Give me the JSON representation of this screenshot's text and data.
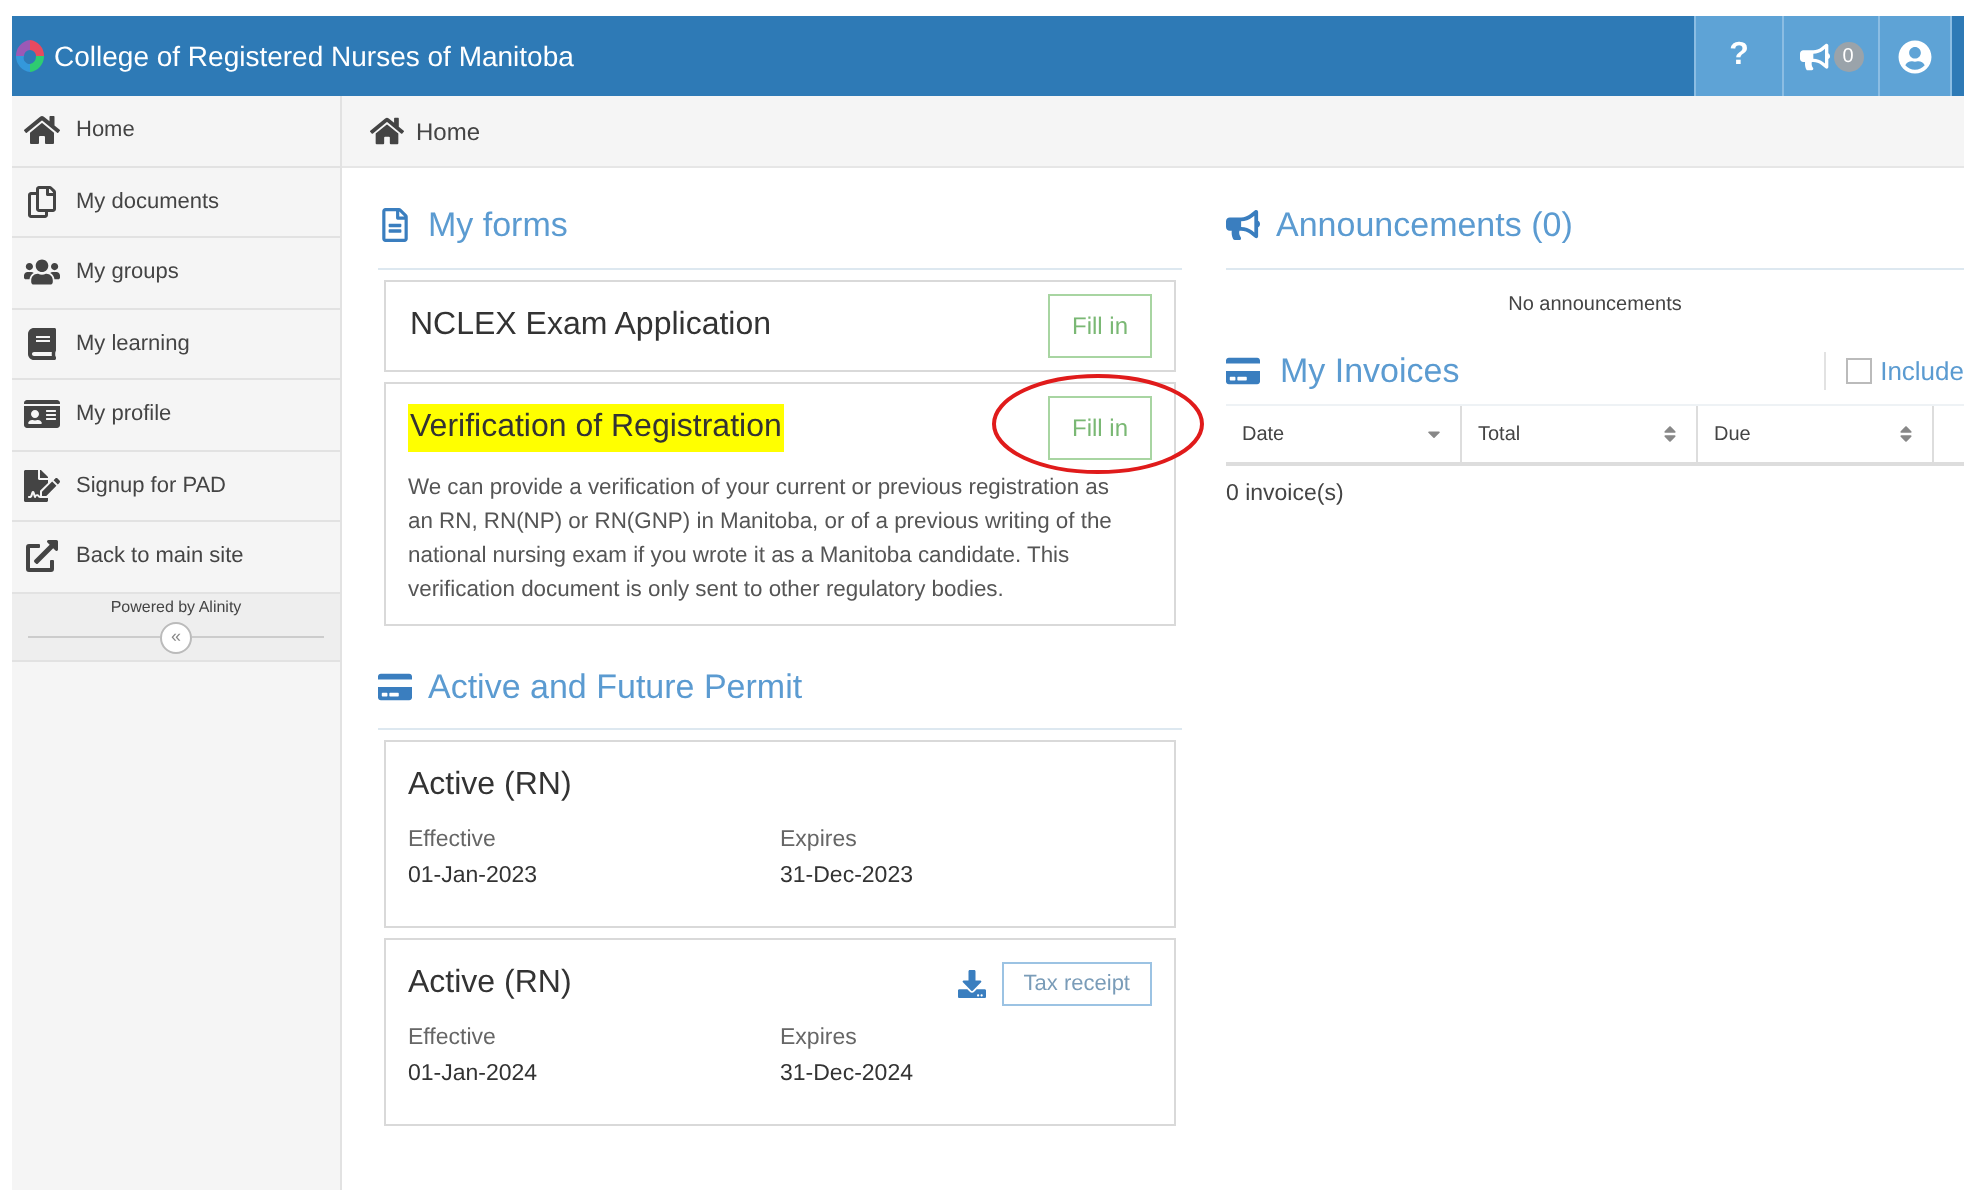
{
  "header": {
    "title": "College of Registered Nurses of Manitoba",
    "help": "?",
    "notification_count": "0"
  },
  "sidebar": {
    "items": [
      {
        "label": "Home"
      },
      {
        "label": "My documents"
      },
      {
        "label": "My groups"
      },
      {
        "label": "My learning"
      },
      {
        "label": "My profile"
      },
      {
        "label": "Signup for PAD"
      },
      {
        "label": "Back to main site"
      }
    ],
    "footer": "Powered by Alinity",
    "collapse": "«"
  },
  "breadcrumb": "Home",
  "my_forms": {
    "title": "My forms",
    "forms": [
      {
        "title": "NCLEX Exam Application",
        "button": "Fill in",
        "highlighted": false,
        "circled": false
      },
      {
        "title": "Verification of Registration",
        "button": "Fill in",
        "highlighted": true,
        "circled": true,
        "description": "We can provide a verification of your current or previous registration as an RN, RN(NP) or RN(GNP) in Manitoba, or of a previous writing of the national nursing exam if you wrote it as a Manitoba candidate. This verification document is only sent to other regulatory bodies."
      }
    ]
  },
  "permits": {
    "title": "Active and Future Permit",
    "items": [
      {
        "title": "Active (RN)",
        "effective_label": "Effective",
        "effective": "01-Jan-2023",
        "expires_label": "Expires",
        "expires": "31-Dec-2023"
      },
      {
        "title": "Active (RN)",
        "effective_label": "Effective",
        "effective": "01-Jan-2024",
        "expires_label": "Expires",
        "expires": "31-Dec-2024",
        "receipt": "Tax receipt"
      }
    ]
  },
  "announcements": {
    "title": "Announcements (0)",
    "empty": "No announcements"
  },
  "invoices": {
    "title": "My Invoices",
    "include_label": "Include",
    "include_checked": false,
    "columns": [
      {
        "label": "Date",
        "sorted": true
      },
      {
        "label": "Total",
        "sorted": false
      },
      {
        "label": "Due",
        "sorted": false
      }
    ],
    "count": "0 invoice(s)"
  }
}
